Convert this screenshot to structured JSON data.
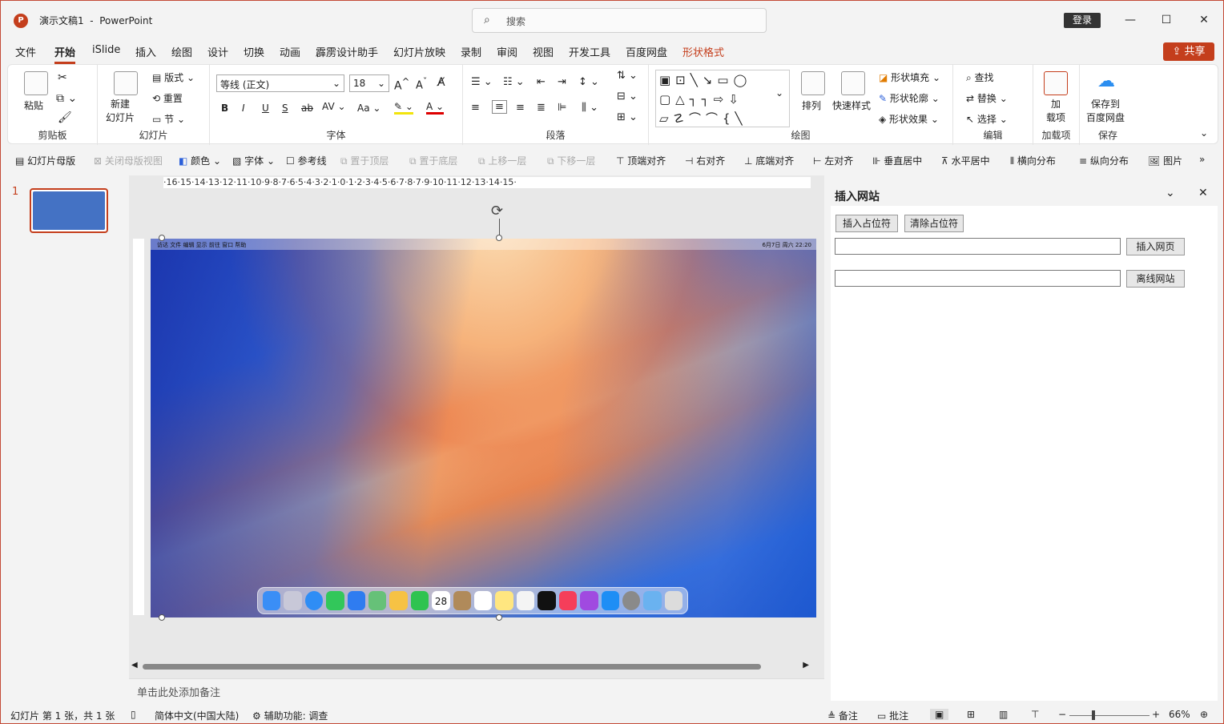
{
  "window": {
    "title": "演示文稿1  -  PowerPoint",
    "app_logo": "P",
    "login": "登录"
  },
  "search": {
    "placeholder": "搜索"
  },
  "menu": [
    "文件",
    "开始",
    "iSlide",
    "插入",
    "绘图",
    "设计",
    "切换",
    "动画",
    "霹雳设计助手",
    "幻灯片放映",
    "录制",
    "审阅",
    "视图",
    "开发工具",
    "百度网盘",
    "形状格式"
  ],
  "share": "共享",
  "ribbon": {
    "clipboard": {
      "paste": "粘贴",
      "label": "剪贴板"
    },
    "slides": {
      "new_slide": "新建\n幻灯片",
      "layout": "版式",
      "reset": "重置",
      "section": "节",
      "label": "幻灯片"
    },
    "font": {
      "name": "等线 (正文)",
      "size": "18",
      "label": "字体"
    },
    "paragraph": {
      "label": "段落"
    },
    "drawing": {
      "arrange": "排列",
      "quick_styles": "快速样式",
      "fill": "形状填充",
      "outline": "形状轮廓",
      "effects": "形状效果",
      "label": "绘图"
    },
    "editing": {
      "find": "查找",
      "replace": "替换",
      "select": "选择",
      "label": "编辑"
    },
    "addins": {
      "load": "加\n载项",
      "label": "加载项"
    },
    "save": {
      "baidu": "保存到\n百度网盘",
      "label": "保存"
    }
  },
  "toolbar2": [
    "幻灯片母版",
    "关闭母版视图",
    "颜色",
    "字体",
    "参考线",
    "置于顶层",
    "置于底层",
    "上移一层",
    "下移一层",
    "顶端对齐",
    "右对齐",
    "底端对齐",
    "左对齐",
    "垂直居中",
    "水平居中",
    "横向分布",
    "纵向分布",
    "图片"
  ],
  "thumbnails": {
    "number": "1"
  },
  "ruler": {
    "h": "·16·15·14·13·12·11·10·9·8·7·6·5·4·3·2·1·0·1·2·3·4·5·6·7·8·7·9·10·11·12·13·14·15·"
  },
  "slide": {
    "mac_menu": "   访达   文件   编辑   显示   前往   窗口   帮助",
    "mac_time": "6月7日  周六  22:20",
    "cal_day": "28"
  },
  "notes": {
    "placeholder": "单击此处添加备注"
  },
  "pane": {
    "title": "插入网站",
    "insert_placeholder": "插入占位符",
    "clear_placeholder": "清除占位符",
    "insert_web": "插入网页",
    "offline_site": "离线网站"
  },
  "status": {
    "slide_info": "幻灯片 第 1 张，共 1 张",
    "lang": "简体中文(中国大陆)",
    "access": "辅助功能: 调查",
    "notes": "备注",
    "comments": "批注",
    "zoom": "66%"
  },
  "colors": {
    "accent": "#c43e1c",
    "slide_blue": "#4472c4"
  }
}
